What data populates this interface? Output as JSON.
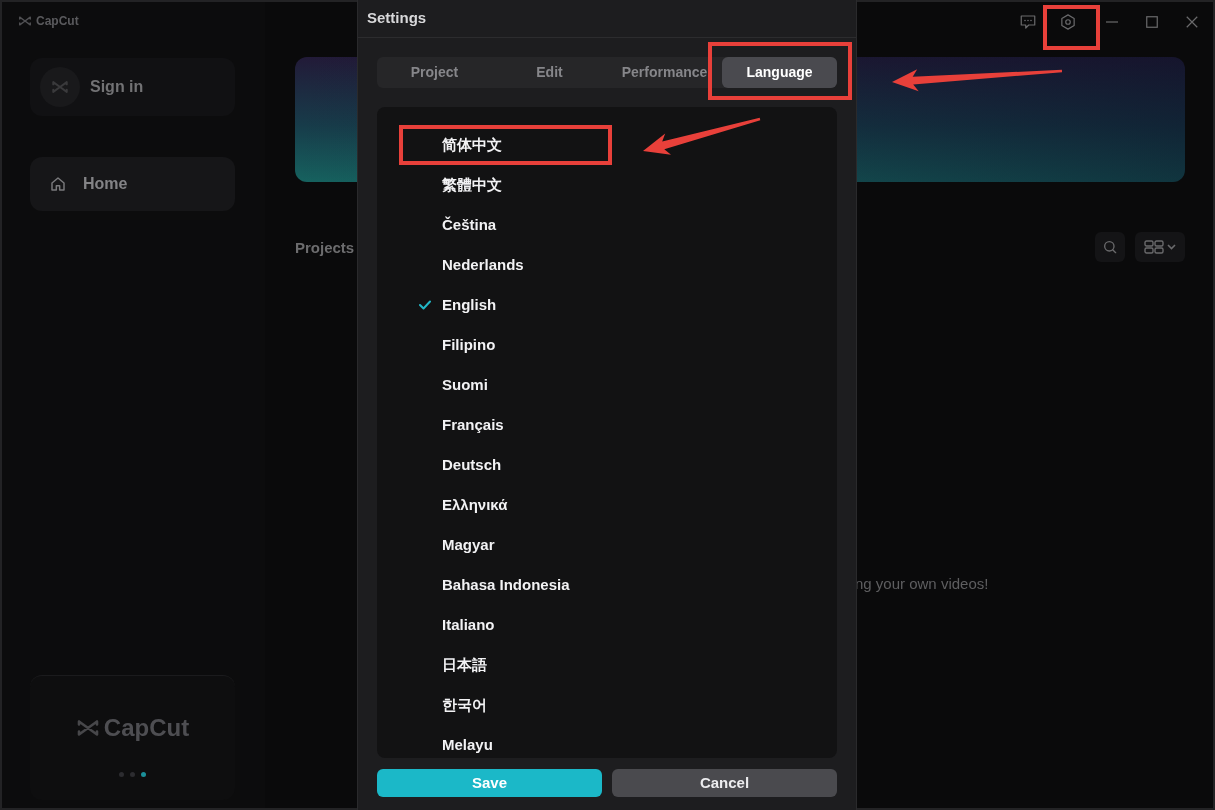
{
  "app": {
    "logo": {
      "text": "CapCut"
    },
    "title_bar": {
      "buttons": [
        {
          "kind": "feedback",
          "highlighted": false
        },
        {
          "kind": "settings",
          "highlighted": true
        },
        {
          "kind": "minimize",
          "highlighted": false
        },
        {
          "kind": "maximize",
          "highlighted": false
        },
        {
          "kind": "close",
          "highlighted": false
        }
      ]
    },
    "sidebar": {
      "sign_in": {
        "label": "Sign in"
      },
      "items": [
        {
          "label": "Home",
          "selected": true
        }
      ],
      "promo": {
        "logo_text": "CapCut",
        "dots": [
          {
            "selected": false
          },
          {
            "selected": false
          },
          {
            "selected": true
          }
        ]
      }
    },
    "projects": {
      "title": "Projects",
      "empty_text": "ng your own videos!"
    }
  },
  "settings_dialog": {
    "title": "Settings",
    "tabs": [
      {
        "label": "Project",
        "selected": false,
        "highlighted": false
      },
      {
        "label": "Edit",
        "selected": false,
        "highlighted": false
      },
      {
        "label": "Performance",
        "selected": false,
        "highlighted": false
      },
      {
        "label": "Language",
        "selected": true,
        "highlighted": true
      }
    ],
    "languages": [
      {
        "label": "简体中文",
        "selected": false,
        "highlighted": true
      },
      {
        "label": "繁體中文",
        "selected": false,
        "highlighted": false
      },
      {
        "label": "Čeština",
        "selected": false,
        "highlighted": false
      },
      {
        "label": "Nederlands",
        "selected": false,
        "highlighted": false
      },
      {
        "label": "English",
        "selected": true,
        "highlighted": false
      },
      {
        "label": "Filipino",
        "selected": false,
        "highlighted": false
      },
      {
        "label": "Suomi",
        "selected": false,
        "highlighted": false
      },
      {
        "label": "Français",
        "selected": false,
        "highlighted": false
      },
      {
        "label": "Deutsch",
        "selected": false,
        "highlighted": false
      },
      {
        "label": "Ελληνικά",
        "selected": false,
        "highlighted": false
      },
      {
        "label": "Magyar",
        "selected": false,
        "highlighted": false
      },
      {
        "label": "Bahasa Indonesia",
        "selected": false,
        "highlighted": false
      },
      {
        "label": "Italiano",
        "selected": false,
        "highlighted": false
      },
      {
        "label": "日本語",
        "selected": false,
        "highlighted": false
      },
      {
        "label": "한국어",
        "selected": false,
        "highlighted": false
      },
      {
        "label": "Melayu",
        "selected": false,
        "highlighted": false
      }
    ],
    "buttons": [
      {
        "label": "Save",
        "kind": "primary"
      },
      {
        "label": "Cancel",
        "kind": "secondary"
      }
    ]
  }
}
